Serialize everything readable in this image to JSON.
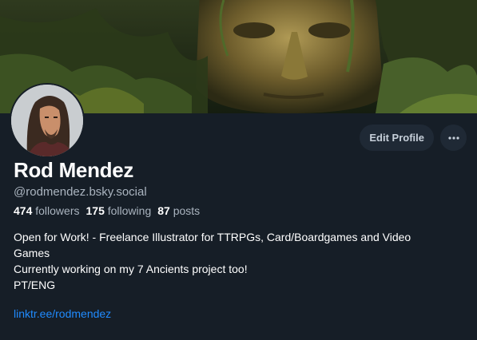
{
  "profile": {
    "display_name": "Rod Mendez",
    "handle": "@rodmendez.bsky.social",
    "followers_count": "474",
    "followers_label": "followers",
    "following_count": "175",
    "following_label": "following",
    "posts_count": "87",
    "posts_label": "posts",
    "bio_lines": [
      "Open for Work! - Freelance Illustrator for TTRPGs, Card/Boardgames and Video",
      "Games",
      "Currently working on my 7 Ancients project too!",
      "PT/ENG"
    ],
    "link": "linktr.ee/rodmendez"
  },
  "actions": {
    "edit_profile": "Edit Profile",
    "more_icon": "ellipsis-icon"
  },
  "colors": {
    "background": "#161e27",
    "button_bg": "#1f2935",
    "link": "#208bfe",
    "secondary_text": "#aab4bf"
  }
}
